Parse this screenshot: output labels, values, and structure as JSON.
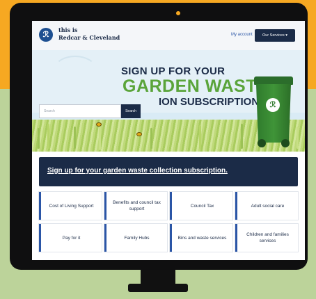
{
  "header": {
    "logo_line1": "this is",
    "logo_line2": "Redcar & Cleveland",
    "account_link": "My account",
    "services_button": "Our Services ▾"
  },
  "hero": {
    "title_line1": "SIGN UP FOR YOUR",
    "title_line2": "GARDEN WASTE",
    "title_line3": "ION SUBSCRIPTION",
    "search_placeholder": "Search",
    "search_button": "Search"
  },
  "banner": {
    "link_text": "Sign up for your garden waste collection subscription."
  },
  "service_tiles": [
    {
      "label": "Cost of Living Support"
    },
    {
      "label": "Benefits and council tax support"
    },
    {
      "label": "Council Tax"
    },
    {
      "label": "Adult social care"
    },
    {
      "label": "Pay for it"
    },
    {
      "label": "Family Hubs"
    },
    {
      "label": "Bins and waste services"
    },
    {
      "label": "Children and families services"
    }
  ],
  "colors": {
    "background_top": "#f6a822",
    "background_bottom": "#bcd39a",
    "navy": "#1b2b47",
    "green": "#5aa43a",
    "accent_blue": "#2a55a6"
  }
}
